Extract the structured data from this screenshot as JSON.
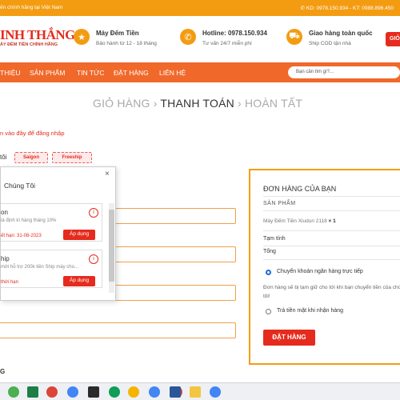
{
  "topbar": {
    "left_text": "ến chính hãng tại Việt Nam",
    "phone_icon": "phone-icon",
    "right_text": "KD: 0978.150.934 - KT: 0988.896.450"
  },
  "header": {
    "logo_main": "INH THẮNG",
    "logo_sub": "ÁY ĐẾM TIỀN CHÍNH HÃNG",
    "info": [
      {
        "icon": "medal-icon",
        "title": "Máy Đếm Tiền",
        "sub": "Bảo hành từ 12 - 18 tháng"
      },
      {
        "icon": "phone-icon",
        "title": "Hotline: 0978.150.934",
        "sub": "Tư vấn 24/7 miễn phí"
      },
      {
        "icon": "truck-icon",
        "title": "Giao hàng toàn quốc",
        "sub": "Ship COD tận nhà"
      }
    ],
    "cart_button": "GIỎ"
  },
  "nav": {
    "items": [
      "THIỆU",
      "SẢN PHẨM",
      "TIN TỨC",
      "ĐẶT HÀNG",
      "LIÊN HỆ"
    ],
    "search_placeholder": "Bạn cần tìm gì?..."
  },
  "steps": {
    "cart": "GIỎ HÀNG",
    "sep1": "›",
    "checkout": "THANH TOÁN",
    "sep2": "›",
    "done": "HOÀN TẤT"
  },
  "login_hint": "n vào đây để đăng nhập",
  "coupon": {
    "label": "tôi",
    "chips": [
      "Saigon",
      "Freeship"
    ]
  },
  "popup": {
    "title": "Chúng Tôi",
    "close": "×",
    "cards": [
      {
        "name": "on",
        "desc": "iá định kì hàng tháng 10%",
        "expiry": "ết hạn: 31-08-2023",
        "info": "i",
        "apply": "Áp dụng"
      },
      {
        "name": "hip",
        "desc": "mới hỗ trợ 200k tiền Ship máy cho...",
        "expiry": "thời hạn",
        "info": "i",
        "apply": "Áp dụng"
      }
    ]
  },
  "bottom_label": "G",
  "order": {
    "title": "ĐƠN HÀNG CỦA BẠN",
    "col_product": "SẢN PHẨM",
    "product_name": "Máy Đếm Tiền Xiudun 2118",
    "product_qty": "× 1",
    "subtotal_label": "Tạm tính",
    "total_label": "Tổng",
    "payment_bank": "Chuyển khoản ngân hàng trực tiếp",
    "payment_bank_desc": "Đơn hàng sẽ bị tạm giữ cho tới khi bạn chuyển tiền của chúng tôi!",
    "payment_cod": "Trả tiền mặt khi nhận hàng",
    "submit": "ĐẶT HÀNG"
  },
  "taskbar": {
    "icons": [
      "chrome-icon",
      "excel-icon",
      "chrome-icon",
      "chrome-icon",
      "chrome-icon",
      "terminal-icon",
      "chrome-icon",
      "chrome-icon",
      "chrome-icon",
      "chrome-icon",
      "word-icon",
      "file-explorer-icon",
      "chrome-icon"
    ]
  }
}
